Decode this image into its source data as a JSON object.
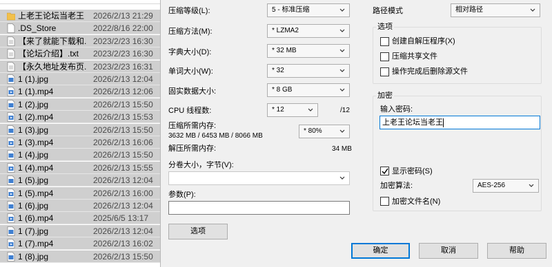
{
  "file_list": {
    "files": [
      {
        "name": "上老王论坛当老王",
        "date": "2026/2/13 21:29",
        "icon": "folder-icon"
      },
      {
        "name": ".DS_Store",
        "date": "2022/8/16 22:00",
        "icon": "file-icon"
      },
      {
        "name": "【来了就能下载和...",
        "date": "2023/2/23 16:30",
        "icon": "text-file-icon"
      },
      {
        "name": "【论坛介绍】.txt",
        "date": "2023/2/23 16:30",
        "icon": "text-file-icon"
      },
      {
        "name": "【永久地址发布页...",
        "date": "2023/2/23 16:31",
        "icon": "text-file-icon"
      },
      {
        "name": "1 (1).jpg",
        "date": "2026/2/13 12:04",
        "icon": "image-file-icon"
      },
      {
        "name": "1 (1).mp4",
        "date": "2026/2/13 12:06",
        "icon": "video-file-icon"
      },
      {
        "name": "1 (2).jpg",
        "date": "2026/2/13 15:50",
        "icon": "image-file-icon"
      },
      {
        "name": "1 (2).mp4",
        "date": "2026/2/13 15:53",
        "icon": "video-file-icon"
      },
      {
        "name": "1 (3).jpg",
        "date": "2026/2/13 15:50",
        "icon": "image-file-icon"
      },
      {
        "name": "1 (3).mp4",
        "date": "2026/2/13 16:06",
        "icon": "video-file-icon"
      },
      {
        "name": "1 (4).jpg",
        "date": "2026/2/13 15:50",
        "icon": "image-file-icon"
      },
      {
        "name": "1 (4).mp4",
        "date": "2026/2/13 15:55",
        "icon": "video-file-icon"
      },
      {
        "name": "1 (5).jpg",
        "date": "2026/2/13 12:04",
        "icon": "image-file-icon"
      },
      {
        "name": "1 (5).mp4",
        "date": "2026/2/13 16:00",
        "icon": "video-file-icon"
      },
      {
        "name": "1 (6).jpg",
        "date": "2026/2/13 12:04",
        "icon": "image-file-icon"
      },
      {
        "name": "1 (6).mp4",
        "date": "2025/6/5 13:17",
        "icon": "video-file-icon"
      },
      {
        "name": "1 (7).jpg",
        "date": "2026/2/13 12:04",
        "icon": "image-file-icon"
      },
      {
        "name": "1 (7).mp4",
        "date": "2026/2/13 16:02",
        "icon": "video-file-icon"
      },
      {
        "name": "1 (8).jpg",
        "date": "2026/2/13 15:50",
        "icon": "image-file-icon"
      }
    ]
  },
  "dialog": {
    "compression_level": {
      "label": "压缩等级(L):",
      "value": "5 - 标准压缩"
    },
    "compression_method": {
      "label": "压缩方法(M):",
      "value": "* LZMA2"
    },
    "dictionary_size": {
      "label": "字典大小(D):",
      "value": "* 32 MB"
    },
    "word_size": {
      "label": "单词大小(W):",
      "value": "* 32"
    },
    "solid_block_size": {
      "label": "固实数据大小:",
      "value": "* 8 GB"
    },
    "cpu_threads": {
      "label": "CPU 线程数:",
      "value": "* 12",
      "max": "/12"
    },
    "memory_compress": {
      "label": "压缩所需内存:",
      "detail": "3632 MB / 6453 MB / 8066 MB",
      "value": "* 80%"
    },
    "memory_decompress": {
      "label": "解压所需内存:",
      "value": "34 MB"
    },
    "split_volumes": {
      "label": "分卷大小，字节(V):",
      "value": ""
    },
    "parameters": {
      "label": "参数(P):",
      "value": ""
    },
    "options_button": "选项",
    "path_mode": {
      "label": "路径模式",
      "value": "相对路径"
    },
    "options_group": {
      "title": "选项",
      "items": [
        {
          "label": "创建自解压程序(X)",
          "checked": false
        },
        {
          "label": "压缩共享文件",
          "checked": false
        },
        {
          "label": "操作完成后删除源文件",
          "checked": false
        }
      ]
    },
    "encryption": {
      "title": "加密",
      "password_label": "输入密码:",
      "password_value": "上老王论坛当老王",
      "show_password": {
        "label": "显示密码(S)",
        "checked": true
      },
      "method_label": "加密算法:",
      "method_value": "AES-256",
      "encrypt_names": {
        "label": "加密文件名(N)",
        "checked": false
      }
    },
    "buttons": {
      "ok": "确定",
      "cancel": "取消",
      "help": "帮助"
    },
    "colors": {
      "accent": "#0078d7",
      "selection": "#cfcfcf",
      "folder": "#f2c04b"
    }
  }
}
